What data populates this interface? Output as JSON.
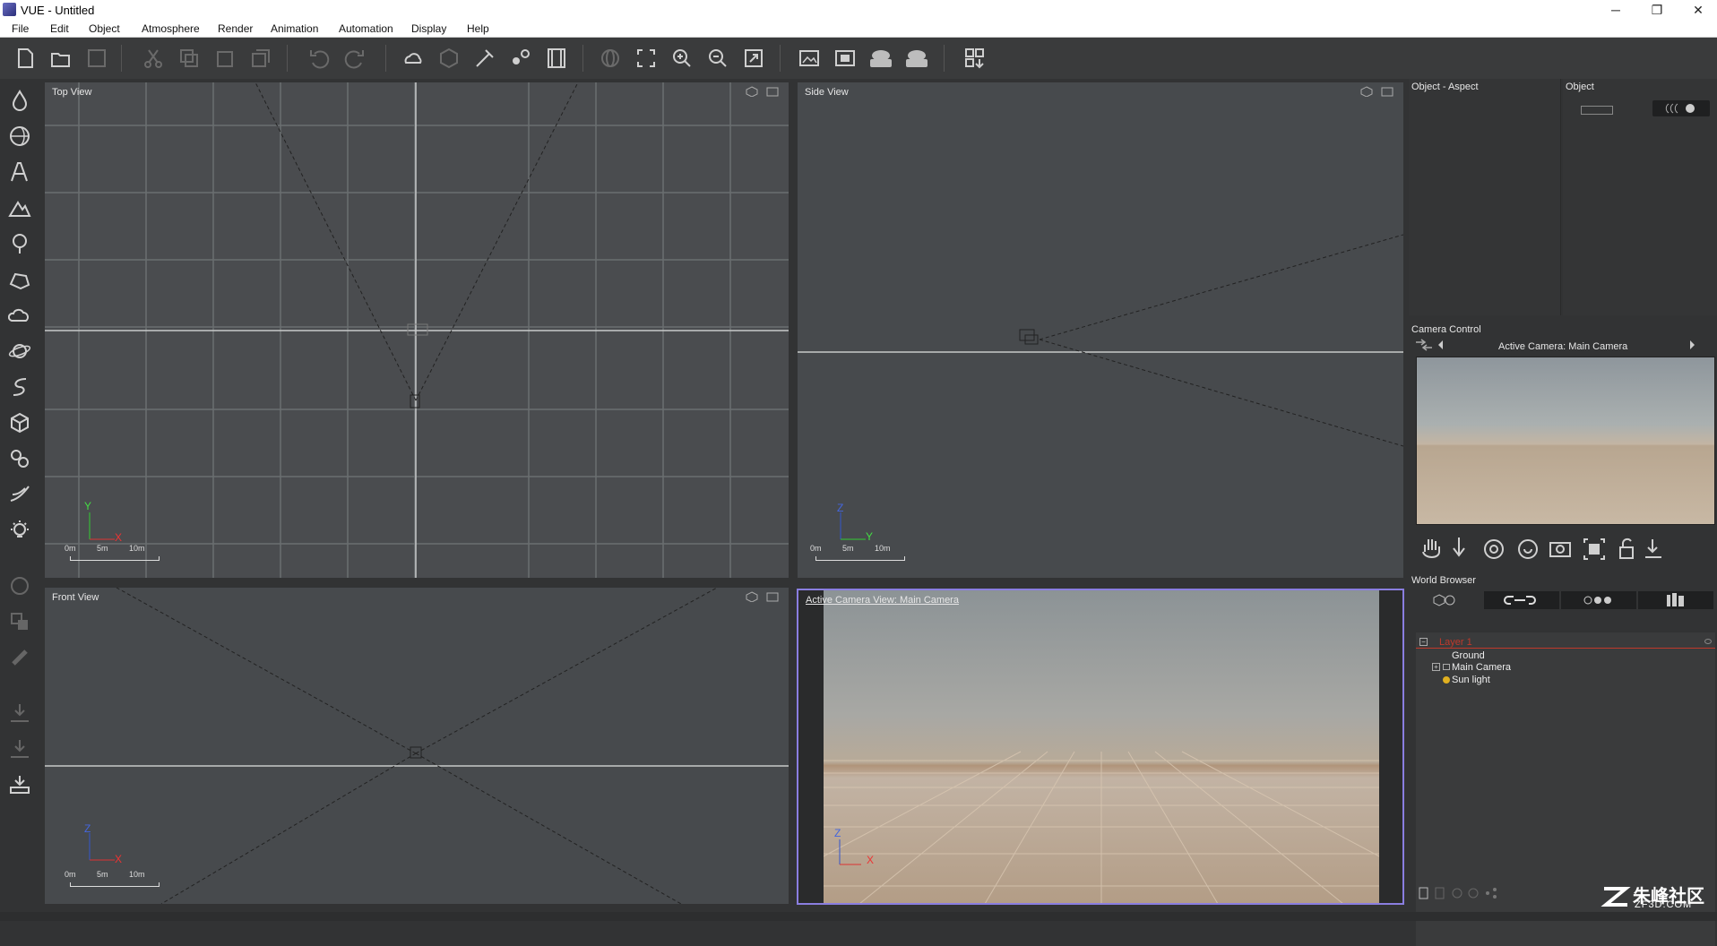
{
  "window": {
    "title": "VUE - Untitled",
    "minimize": "─",
    "maximize": "❐",
    "close": "✕"
  },
  "menu": [
    "File",
    "Edit",
    "Object",
    "Atmosphere",
    "Render",
    "Animation",
    "Automation",
    "Display",
    "Help"
  ],
  "viewports": {
    "top": {
      "title": "Top View"
    },
    "side": {
      "title": "Side View"
    },
    "front": {
      "title": "Front View"
    },
    "camera": {
      "title": "Active Camera View: Main Camera"
    }
  },
  "scale": {
    "t0": "0m",
    "t1": "5m",
    "t2": "10m"
  },
  "axes": {
    "x": "X",
    "y": "Y",
    "z": "Z"
  },
  "panels": {
    "aspect_title": "Object - Aspect",
    "object_title": "Object",
    "camera_control": "Camera Control",
    "active_camera": "Active Camera: Main Camera",
    "world_browser": "World Browser"
  },
  "world_browser": {
    "items": [
      "Layer 1",
      "Ground",
      "Main Camera",
      "Sun light"
    ]
  },
  "watermark": {
    "brand": "朱峰社区",
    "site": "ZF3D.COM"
  },
  "colors": {
    "accent": "#8a7ee0",
    "layer": "#c0392b"
  }
}
